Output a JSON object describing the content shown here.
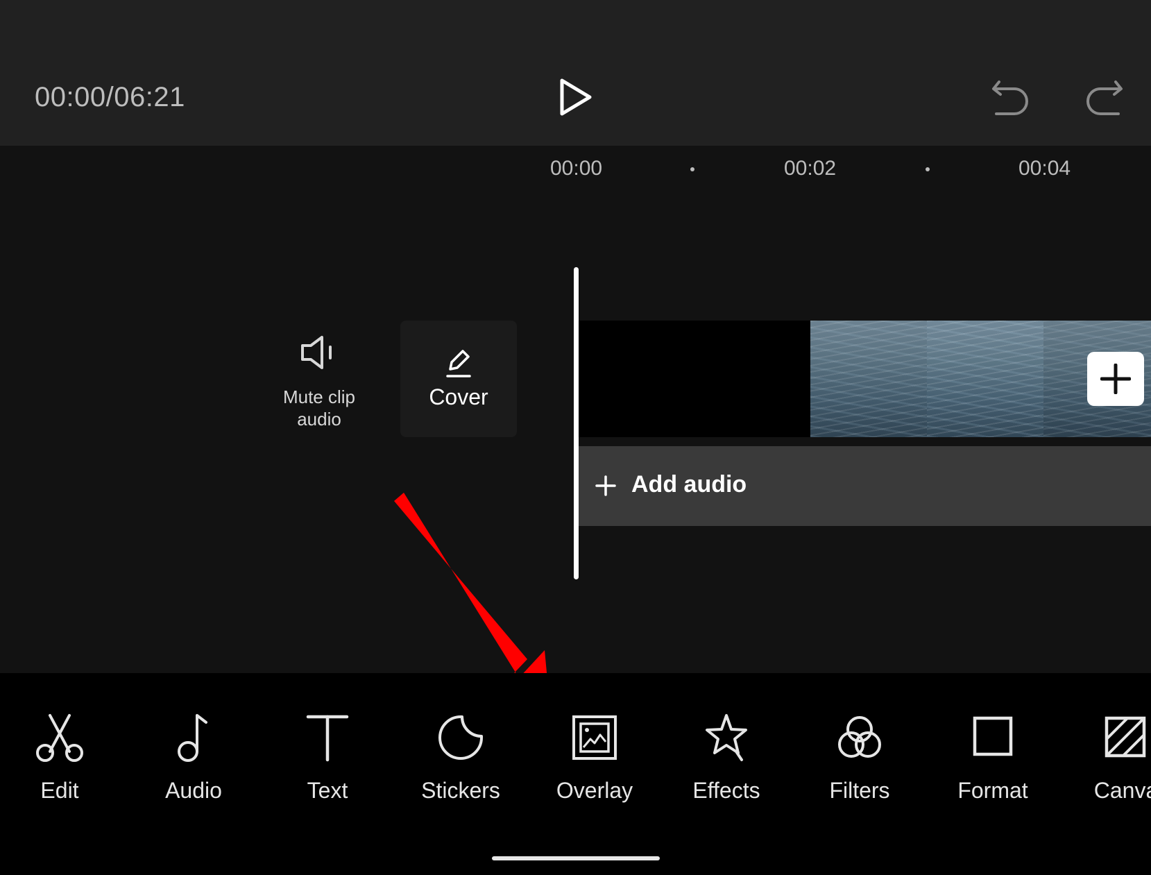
{
  "player": {
    "time": "00:00/06:21"
  },
  "icons": {
    "play": "play-icon",
    "undo": "undo-icon",
    "redo": "redo-icon"
  },
  "ruler": {
    "ticks": [
      "00:00",
      "00:02",
      "00:04"
    ]
  },
  "left_tools": {
    "mute_label": "Mute clip audio",
    "cover_label": "Cover"
  },
  "timeline": {
    "add_audio_label": "Add audio"
  },
  "toolbar": {
    "items": [
      {
        "label": "Edit",
        "icon": "scissors-icon"
      },
      {
        "label": "Audio",
        "icon": "music-note-icon"
      },
      {
        "label": "Text",
        "icon": "text-icon"
      },
      {
        "label": "Stickers",
        "icon": "sticker-icon"
      },
      {
        "label": "Overlay",
        "icon": "overlay-icon"
      },
      {
        "label": "Effects",
        "icon": "effects-star-icon"
      },
      {
        "label": "Filters",
        "icon": "filters-icon"
      },
      {
        "label": "Format",
        "icon": "format-square-icon"
      },
      {
        "label": "Canva",
        "icon": "canvas-icon"
      }
    ]
  },
  "colors": {
    "annotation_arrow": "#ff0000",
    "background": "#121212",
    "topbar": "#212121",
    "toolbar": "#000000"
  }
}
